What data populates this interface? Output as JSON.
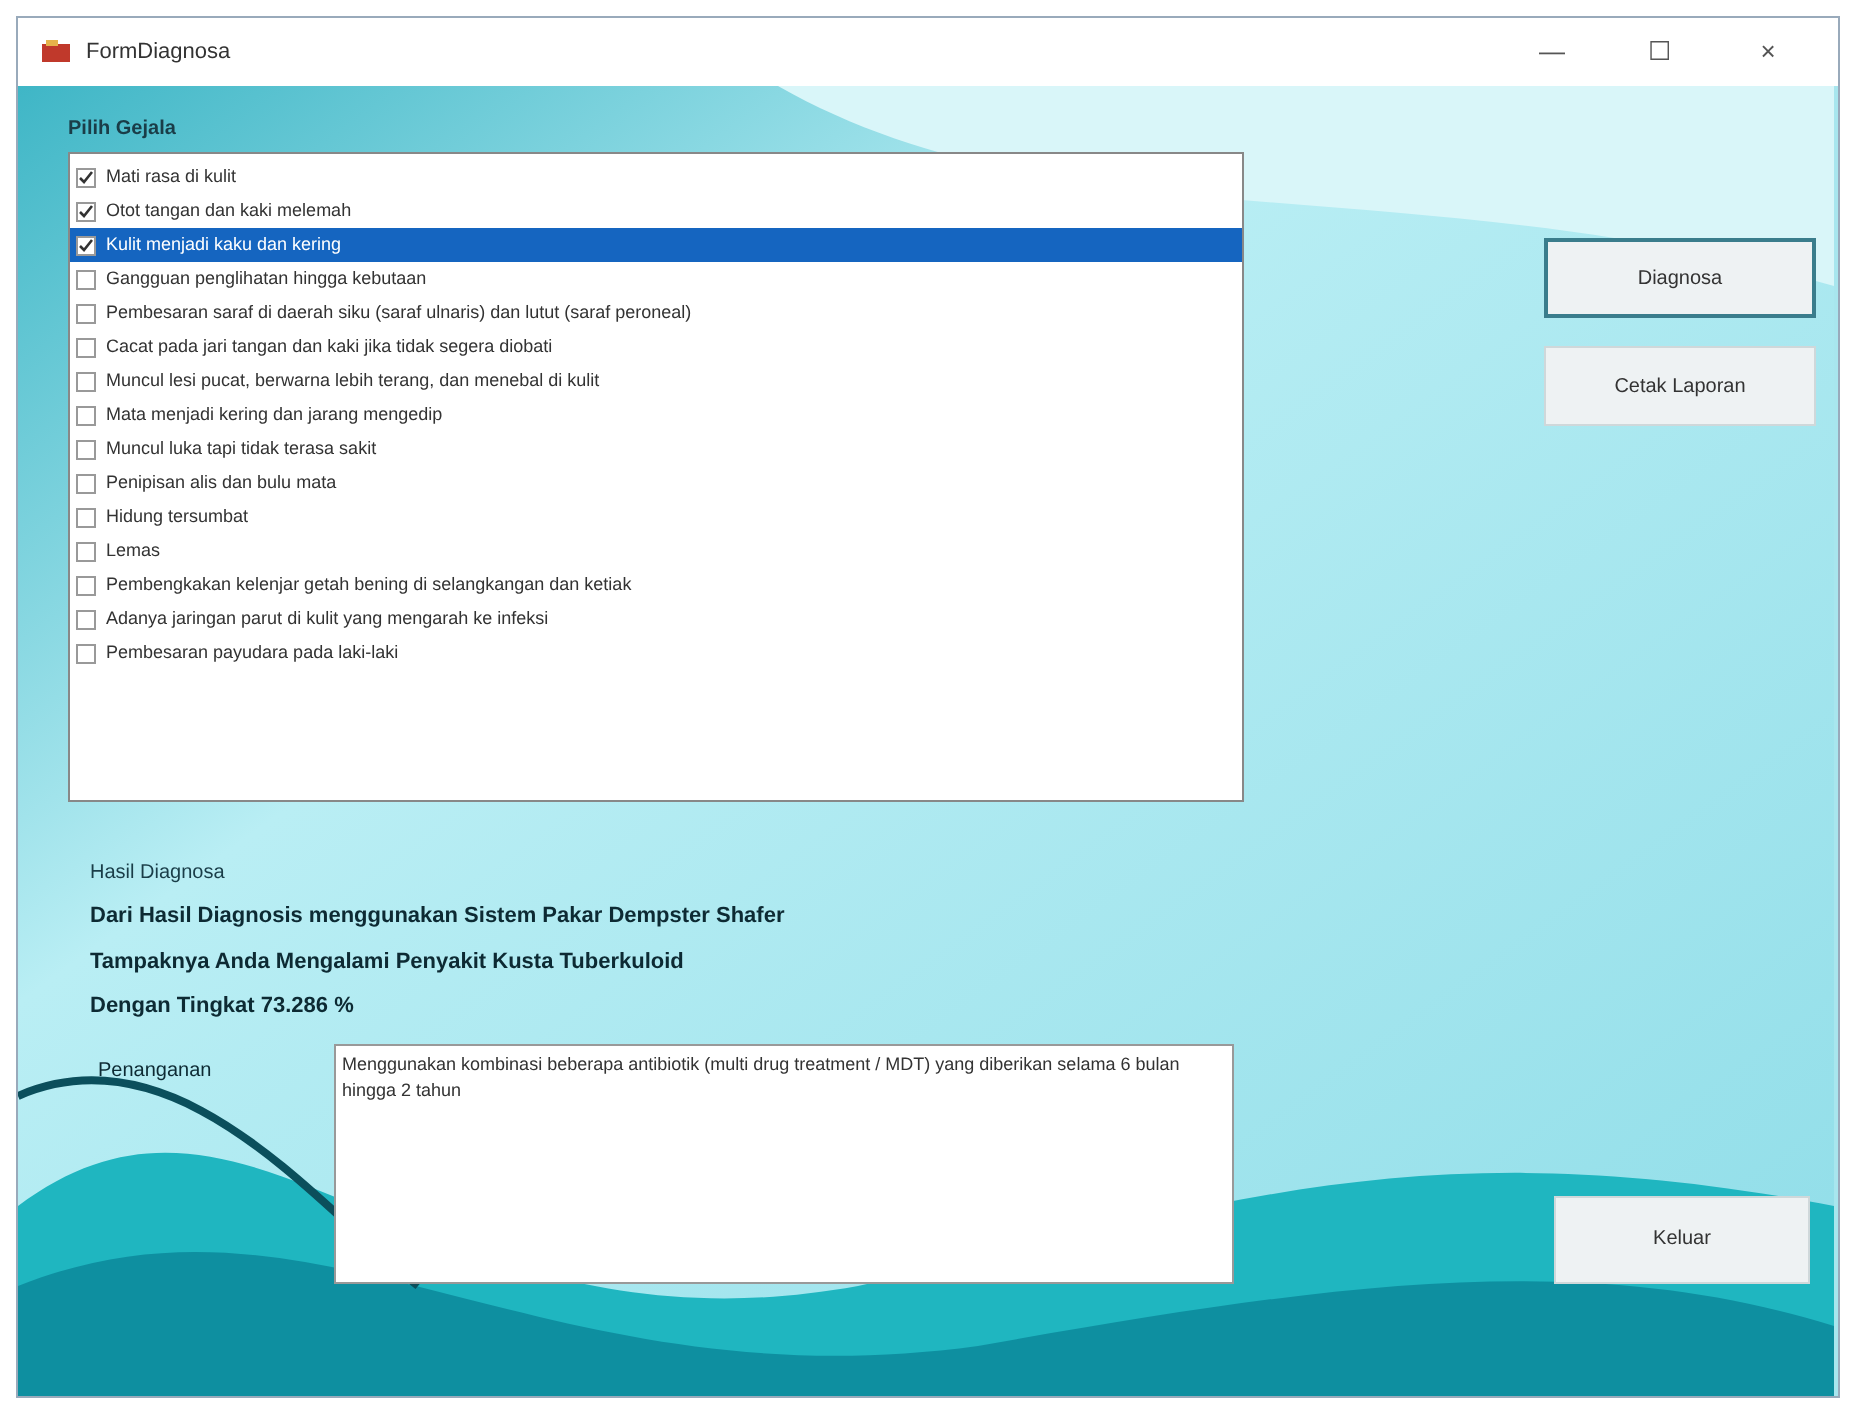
{
  "window": {
    "title": "FormDiagnosa",
    "controls": [
      "—",
      "☐",
      "×"
    ]
  },
  "symptoms": {
    "label": "Pilih Gejala",
    "items": [
      {
        "label": "Mati rasa di kulit",
        "checked": true,
        "selected": false
      },
      {
        "label": "Otot tangan dan kaki melemah",
        "checked": true,
        "selected": false
      },
      {
        "label": "Kulit menjadi kaku dan kering",
        "checked": true,
        "selected": true
      },
      {
        "label": "Gangguan penglihatan hingga kebutaan",
        "checked": false,
        "selected": false
      },
      {
        "label": "Pembesaran saraf di daerah siku (saraf ulnaris) dan lutut (saraf peroneal)",
        "checked": false,
        "selected": false
      },
      {
        "label": "Cacat pada jari tangan dan kaki jika tidak segera diobati",
        "checked": false,
        "selected": false
      },
      {
        "label": "Muncul lesi pucat, berwarna lebih terang, dan menebal di kulit",
        "checked": false,
        "selected": false
      },
      {
        "label": "Mata menjadi kering dan jarang mengedip",
        "checked": false,
        "selected": false
      },
      {
        "label": "Muncul luka tapi tidak terasa sakit",
        "checked": false,
        "selected": false
      },
      {
        "label": "Penipisan alis dan bulu mata",
        "checked": false,
        "selected": false
      },
      {
        "label": "Hidung tersumbat",
        "checked": false,
        "selected": false
      },
      {
        "label": "Lemas",
        "checked": false,
        "selected": false
      },
      {
        "label": "Pembengkakan kelenjar getah bening di selangkangan dan ketiak",
        "checked": false,
        "selected": false
      },
      {
        "label": "Adanya jaringan parut di kulit yang mengarah ke infeksi",
        "checked": false,
        "selected": false
      },
      {
        "label": "Pembesaran payudara pada laki-laki",
        "checked": false,
        "selected": false
      }
    ]
  },
  "actions": [
    {
      "label": "Diagnosa",
      "focused": true
    },
    {
      "label": "Cetak Laporan",
      "focused": false
    }
  ],
  "result": {
    "label": "Hasil Diagnosa",
    "lines": [
      "Dari Hasil Diagnosis menggunakan Sistem Pakar Dempster Shafer",
      "Tampaknya Anda Mengalami Penyakit Kusta Tuberkuloid",
      "Dengan Tingkat 73.286 %"
    ]
  },
  "treatment": {
    "label": "Penanganan",
    "value": "Menggunakan kombinasi beberapa antibiotik (multi drug treatment / MDT) yang diberikan selama 6 bulan hingga 2 tahun"
  },
  "exit_button": "Keluar"
}
